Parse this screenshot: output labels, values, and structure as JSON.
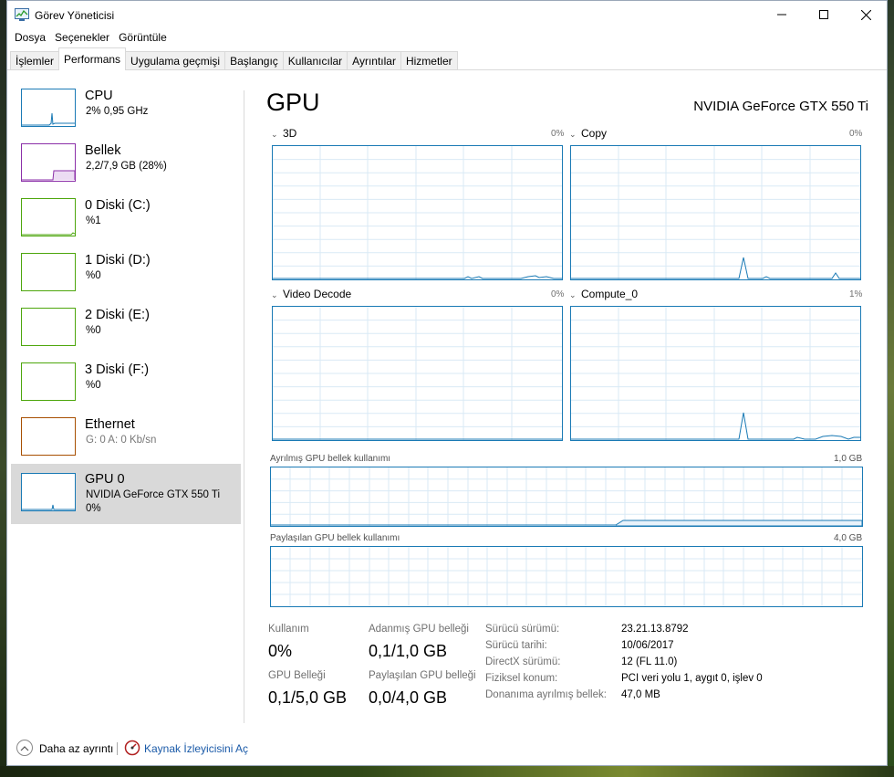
{
  "window": {
    "title": "Görev Yöneticisi",
    "min_icon": "minimize-icon",
    "max_icon": "maximize-icon",
    "close_icon": "close-icon"
  },
  "menu": [
    "Dosya",
    "Seçenekler",
    "Görüntüle"
  ],
  "tabs": [
    "İşlemler",
    "Performans",
    "Uygulama geçmişi",
    "Başlangıç",
    "Kullanıcılar",
    "Ayrıntılar",
    "Hizmetler"
  ],
  "active_tab": "Performans",
  "sidebar": {
    "items": [
      {
        "name": "CPU",
        "sub": "2% 0,95 GHz",
        "color": "#1a7ab5"
      },
      {
        "name": "Bellek",
        "sub": "2,2/7,9 GB (28%)",
        "color": "#8b2fa8"
      },
      {
        "name": "0 Diski (C:)",
        "sub": "%1",
        "color": "#4da60c"
      },
      {
        "name": "1 Diski (D:)",
        "sub": "%0",
        "color": "#4da60c"
      },
      {
        "name": "2 Diski (E:)",
        "sub": "%0",
        "color": "#4da60c"
      },
      {
        "name": "3 Diski (F:)",
        "sub": "%0",
        "color": "#4da60c"
      },
      {
        "name": "Ethernet",
        "sub_muted": "G: 0 A: 0 Kb/sn",
        "color": "#a74f01"
      },
      {
        "name": "GPU 0",
        "sub": "NVIDIA GeForce GTX 550 Ti",
        "sub2": "0%",
        "color": "#1a7ab5",
        "selected": true
      }
    ]
  },
  "main": {
    "title": "GPU",
    "model": "NVIDIA GeForce GTX 550 Ti",
    "engines": [
      {
        "label": "3D",
        "pct": "0%"
      },
      {
        "label": "Copy",
        "pct": "0%"
      },
      {
        "label": "Video Decode",
        "pct": "0%"
      },
      {
        "label": "Compute_0",
        "pct": "1%"
      }
    ],
    "dedicated_mem": {
      "label": "Ayrılmış GPU bellek kullanımı",
      "max": "1,0 GB",
      "level": 0.1
    },
    "shared_mem": {
      "label": "Paylaşılan GPU bellek kullanımı",
      "max": "4,0 GB",
      "level": 0.0
    },
    "stats": {
      "usage_label": "Kullanım",
      "usage_value": "0%",
      "gpu_mem_label": "GPU Belleği",
      "gpu_mem_value": "0,1/5,0 GB",
      "dedicated_label": "Adanmış GPU belleği",
      "dedicated_value": "0,1/1,0 GB",
      "shared_label": "Paylaşılan GPU belleği",
      "shared_value": "0,0/4,0 GB"
    },
    "info": [
      {
        "key": "Sürücü sürümü:",
        "value": "23.21.13.8792"
      },
      {
        "key": "Sürücü tarihi:",
        "value": "10/06/2017"
      },
      {
        "key": "DirectX sürümü:",
        "value": "12 (FL 11.0)"
      },
      {
        "key": "Fiziksel konum:",
        "value": "PCI veri yolu 1, aygıt 0, işlev 0"
      },
      {
        "key": "Donanıma ayrılmış bellek:",
        "value": "47,0 MB"
      }
    ]
  },
  "footer": {
    "less_label": "Daha az ayrıntı",
    "resmon_label": "Kaynak İzleyicisini Aç"
  },
  "colors": {
    "gpu_accent": "#1a7ab5",
    "link": "#1a5aa8"
  }
}
